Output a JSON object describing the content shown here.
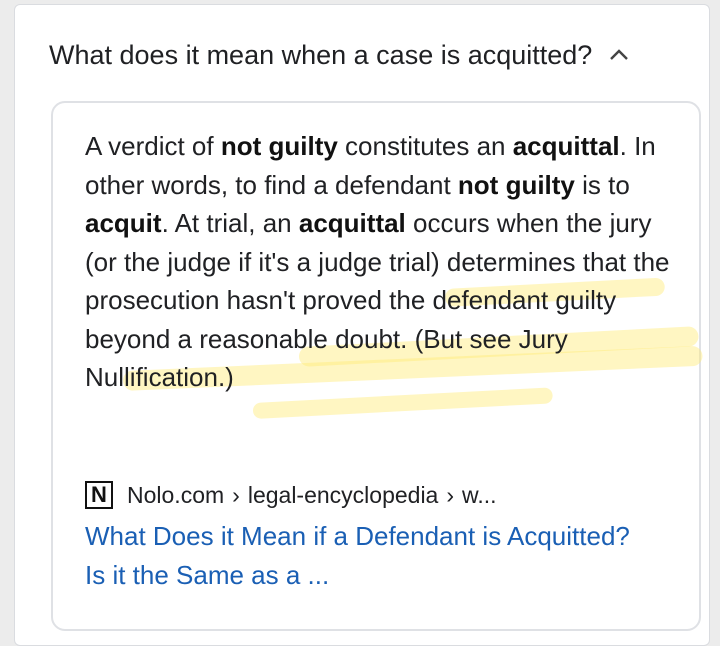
{
  "question": {
    "text": "What does it mean when a case is acquitted?",
    "expand_icon": "chevron-up-icon"
  },
  "answer": {
    "segments": [
      {
        "t": "A verdict of "
      },
      {
        "b": "not guilty"
      },
      {
        "t": " constitutes an "
      },
      {
        "b": "acquittal"
      },
      {
        "t": ". In other words, to find a defendant "
      },
      {
        "b": "not guilty"
      },
      {
        "t": " is to "
      },
      {
        "b": "acquit"
      },
      {
        "t": ". At trial, an "
      },
      {
        "b": "acquittal"
      },
      {
        "t": " occurs when the jury (or the judge if it's a judge trial) determines that the prosecution hasn't proved the defendant guilty beyond a reasonable doubt. (But see Jury Nullification.)"
      }
    ]
  },
  "source": {
    "favicon_letter": "N",
    "site": "Nolo.com",
    "path1": "legal-encyclopedia",
    "path2": "w...",
    "separator": "›"
  },
  "result": {
    "link_text": "What Does it Mean if a Defendant is Acquitted? Is it the Same as a ..."
  },
  "colors": {
    "link": "#1a5fb4",
    "highlight": "#ffe878"
  }
}
